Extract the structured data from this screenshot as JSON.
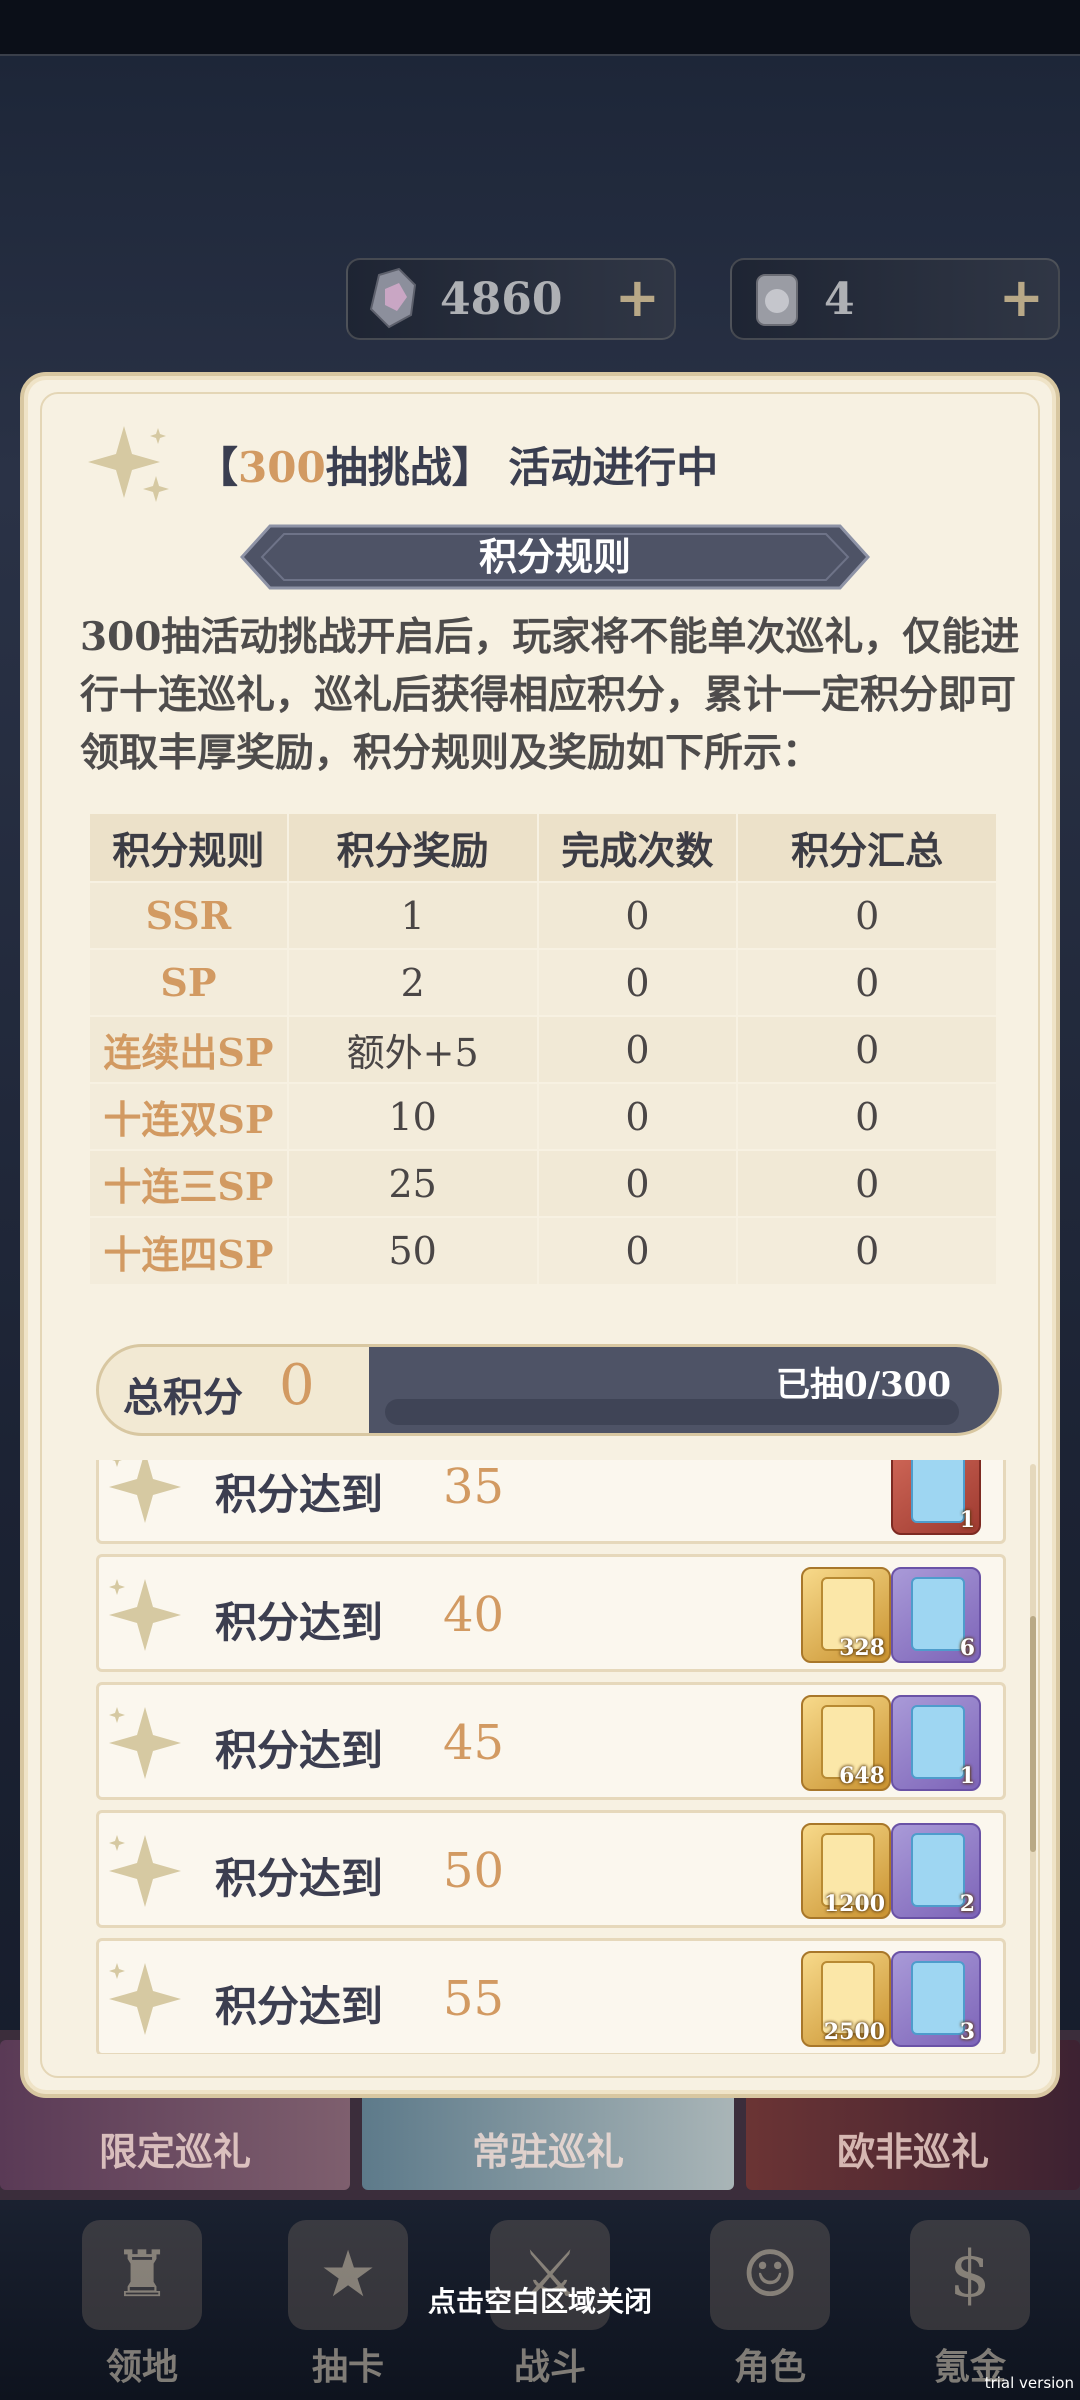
{
  "currency": {
    "gem": {
      "value": "4860",
      "plus": "+",
      "icon": "crystal-icon"
    },
    "ticket": {
      "value": "4",
      "plus": "+",
      "icon": "scroll-icon"
    }
  },
  "panel": {
    "title_prefix": "【",
    "title_highlight": "300",
    "title_suffix": "抽挑战】 活动进行中",
    "ribbon": "积分规则",
    "description": "300抽活动挑战开启后，玩家将不能单次巡礼，仅能进行十连巡礼，巡礼后获得相应积分，累计一定积分即可领取丰厚奖励，积分规则及奖励如下所示："
  },
  "table": {
    "headers": [
      "积分规则",
      "积分奖励",
      "完成次数",
      "积分汇总"
    ],
    "rows": [
      [
        "SSR",
        "1",
        "0",
        "0"
      ],
      [
        "SP",
        "2",
        "0",
        "0"
      ],
      [
        "连续出SP",
        "额外+5",
        "0",
        "0"
      ],
      [
        "十连双SP",
        "10",
        "0",
        "0"
      ],
      [
        "十连三SP",
        "25",
        "0",
        "0"
      ],
      [
        "十连四SP",
        "50",
        "0",
        "0"
      ]
    ]
  },
  "total": {
    "label": "总积分",
    "value": "0",
    "progress_text": "已抽0/300",
    "progress_fraction": 0
  },
  "rewards": {
    "label": "积分达到",
    "rows": [
      {
        "target": "35",
        "items": [
          {
            "type": "red",
            "count": "1"
          }
        ]
      },
      {
        "target": "40",
        "items": [
          {
            "type": "gold",
            "count": "328"
          },
          {
            "type": "purple",
            "count": "6"
          }
        ]
      },
      {
        "target": "45",
        "items": [
          {
            "type": "gold",
            "count": "648"
          },
          {
            "type": "purple",
            "count": "1"
          }
        ]
      },
      {
        "target": "50",
        "items": [
          {
            "type": "gold",
            "count": "1200"
          },
          {
            "type": "purple",
            "count": "2"
          }
        ]
      },
      {
        "target": "55",
        "items": [
          {
            "type": "gold",
            "count": "2500"
          },
          {
            "type": "purple",
            "count": "3"
          }
        ]
      }
    ]
  },
  "background_tabs": [
    "限定巡礼",
    "常驻巡礼",
    "欧非巡礼"
  ],
  "nav": [
    "领地",
    "抽卡",
    "战斗",
    "角色",
    "氪金"
  ],
  "close_hint": "点击空白区域关闭",
  "watermark": "trial version",
  "colors": {
    "accent": "#d29a62",
    "panel": "#f7f1e2",
    "ribbon": "#4e5366",
    "text_dark": "#3c3e50"
  }
}
